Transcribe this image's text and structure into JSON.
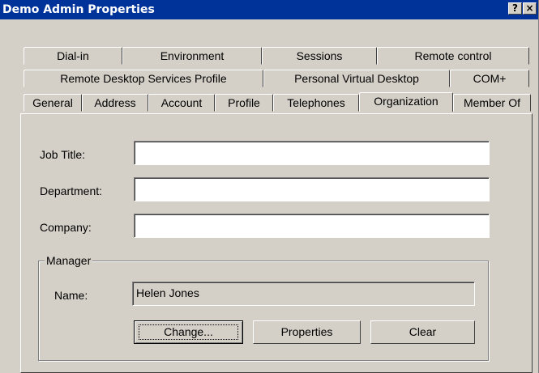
{
  "window": {
    "title": "Demo Admin Properties",
    "help_label": "?",
    "close_label": "×"
  },
  "tabs": {
    "row1": [
      "Dial-in",
      "Environment",
      "Sessions",
      "Remote control"
    ],
    "row2": [
      "Remote Desktop Services Profile",
      "Personal Virtual Desktop",
      "COM+"
    ],
    "row3": [
      "General",
      "Address",
      "Account",
      "Profile",
      "Telephones",
      "Organization",
      "Member Of"
    ],
    "selected": "Organization"
  },
  "form": {
    "job_title_label": "Job Title:",
    "job_title_value": "",
    "department_label": "Department:",
    "department_value": "",
    "company_label": "Company:",
    "company_value": ""
  },
  "manager": {
    "group_label": "Manager",
    "name_label": "Name:",
    "name_value": "Helen Jones",
    "change_label": "Change...",
    "properties_label": "Properties",
    "clear_label": "Clear"
  }
}
